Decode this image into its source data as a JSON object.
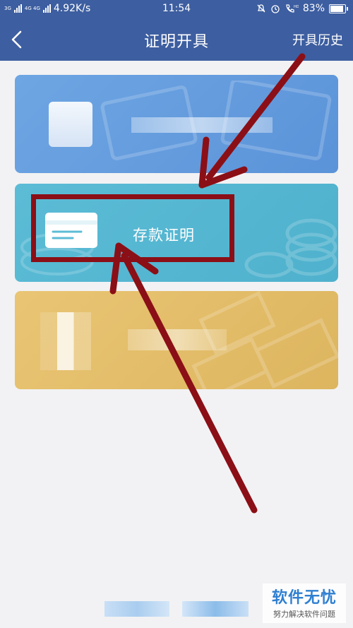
{
  "status_bar": {
    "network_small": "3G",
    "network_type": "4G 4G",
    "speed": "4.92K/s",
    "time": "11:54",
    "battery": "83%"
  },
  "header": {
    "title": "证明开具",
    "history_label": "开具历史"
  },
  "cards": [
    {
      "label": ""
    },
    {
      "label": "存款证明"
    },
    {
      "label": ""
    }
  ],
  "watermark": {
    "main": "软件无忧",
    "sub": "努力解决软件问题"
  },
  "colors": {
    "header_bg": "#3d5ea0",
    "card1": "#6ea6e3",
    "card2": "#5cbcd6",
    "card3": "#e9c574",
    "annotation": "#8b0f16"
  }
}
